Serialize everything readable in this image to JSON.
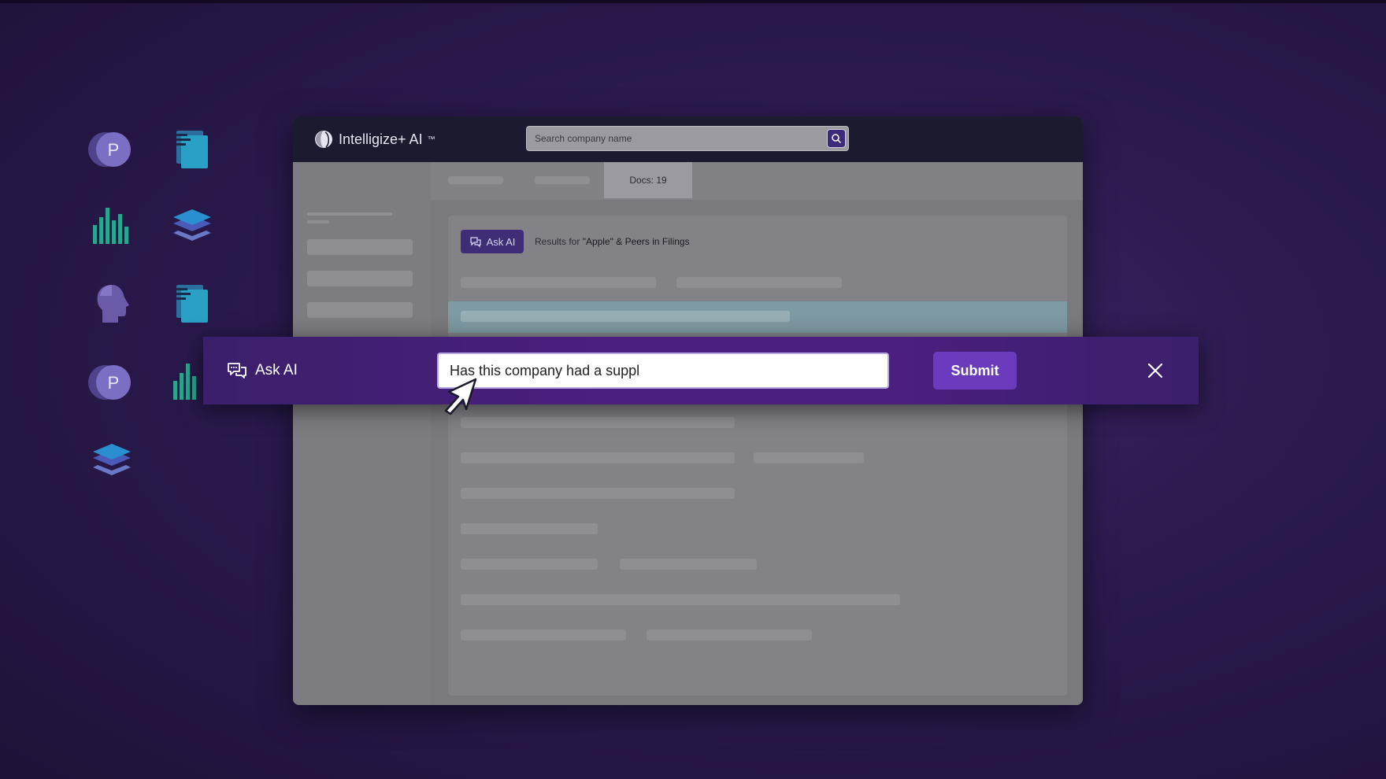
{
  "app": {
    "brand_name": "Intelligize+ AI",
    "brand_tm": "™"
  },
  "search": {
    "placeholder": "Search company name"
  },
  "tabs": {
    "docs_label": "Docs: 19"
  },
  "results": {
    "ask_ai_label": "Ask AI",
    "prefix": "Results for ",
    "query": "\"Apple\"",
    "suffix": " & Peers in Filings"
  },
  "ask_bar": {
    "title": "Ask AI",
    "input_value": "Has this company had a suppl",
    "submit_label": "Submit"
  },
  "deco_icons": {
    "p_letter": "P"
  },
  "colors": {
    "accent": "#6a3bbd",
    "bar": "#4a1f7e",
    "appbar": "#1c1a2e"
  }
}
